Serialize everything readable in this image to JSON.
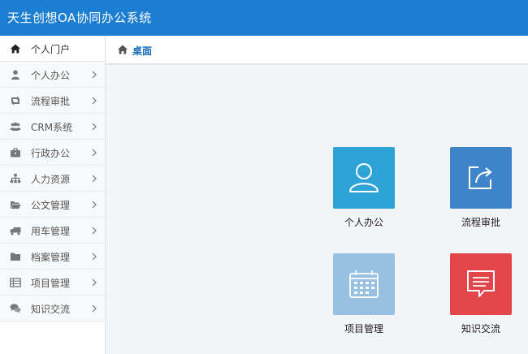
{
  "app": {
    "title": "天生创想OA协同办公系统"
  },
  "sidebar": {
    "items": [
      {
        "label": "个人门户",
        "icon": "home-icon"
      },
      {
        "label": "个人办公",
        "icon": "user-icon"
      },
      {
        "label": "流程审批",
        "icon": "retweet-icon"
      },
      {
        "label": "CRM系统",
        "icon": "group-icon"
      },
      {
        "label": "行政办公",
        "icon": "briefcase-icon"
      },
      {
        "label": "人力资源",
        "icon": "sitemap-icon"
      },
      {
        "label": "公文管理",
        "icon": "folder-open-icon"
      },
      {
        "label": "用车管理",
        "icon": "truck-icon"
      },
      {
        "label": "档案管理",
        "icon": "folder-icon"
      },
      {
        "label": "项目管理",
        "icon": "list-icon"
      },
      {
        "label": "知识交流",
        "icon": "comments-icon"
      }
    ]
  },
  "breadcrumb": {
    "label": "桌面"
  },
  "desktop": {
    "tiles": [
      {
        "label": "个人办公",
        "icon": "user-outline-icon",
        "color": "#2ea3d5"
      },
      {
        "label": "流程审批",
        "icon": "share-box-icon",
        "color": "#3f84c8"
      },
      {
        "label": "项目管理",
        "icon": "calendar-icon",
        "color": "#98c0e0"
      },
      {
        "label": "知识交流",
        "icon": "message-icon",
        "color": "#e2464a"
      }
    ]
  },
  "colors": {
    "header": "#1b7ed0",
    "link": "#1b6fb5",
    "background": "#f3f4f7"
  }
}
